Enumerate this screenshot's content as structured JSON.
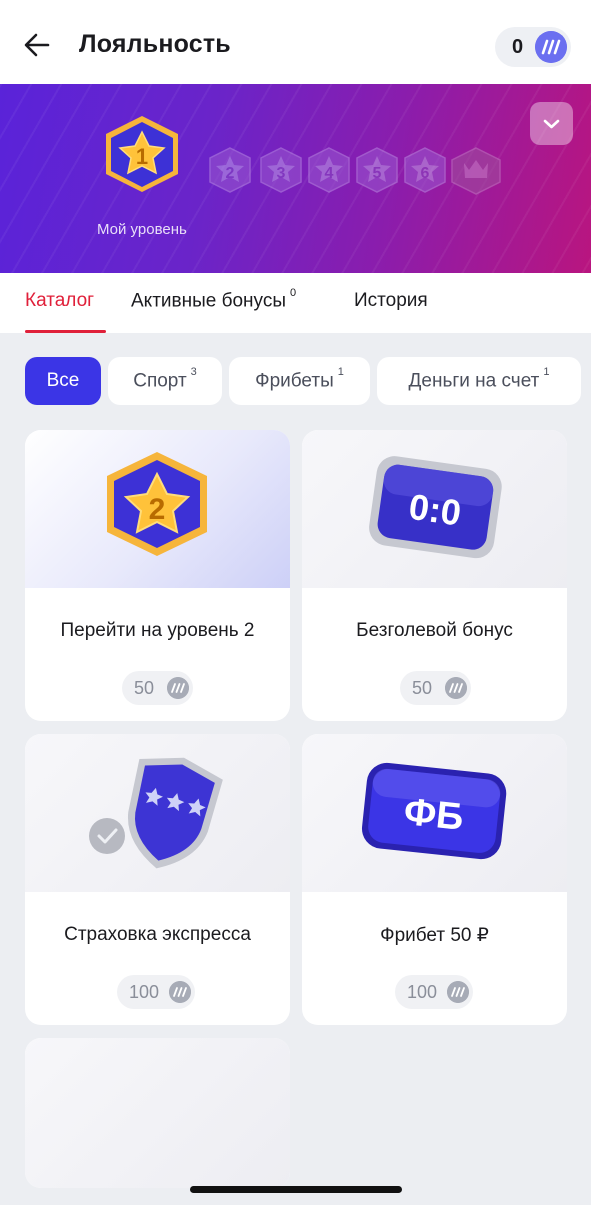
{
  "header": {
    "title": "Лояльность",
    "balance": "0",
    "back_icon": "arrow-left-icon",
    "coin_icon": "loyalty-coin-icon"
  },
  "level": {
    "current": "1",
    "levels": [
      "1",
      "2",
      "3",
      "4",
      "5",
      "6"
    ],
    "caption": "Мой уровень",
    "expand_icon": "chevron-down-icon",
    "final_icon": "crown-icon"
  },
  "tabs": [
    {
      "label": "Каталог",
      "count": ""
    },
    {
      "label": "Активные бонусы",
      "count": "0"
    },
    {
      "label": "История",
      "count": ""
    }
  ],
  "filters": [
    {
      "label": "Все",
      "count": ""
    },
    {
      "label": "Спорт",
      "count": "3"
    },
    {
      "label": "Фрибеты",
      "count": "1"
    },
    {
      "label": "Деньги на счет",
      "count": "1"
    }
  ],
  "cards": [
    {
      "title": "Перейти на уровень 2",
      "price": "50",
      "icon": "level-2-badge-icon"
    },
    {
      "title": "Безголевой бонус",
      "price": "50",
      "icon": "score-0-0-icon",
      "icon_text": "0:0"
    },
    {
      "title": "Страховка экспресса",
      "price": "100",
      "icon": "insurance-shield-icon"
    },
    {
      "title": "Фрибет 50 ₽",
      "price": "100",
      "icon": "freebet-icon",
      "icon_text": "ФБ"
    }
  ],
  "colors": {
    "accent": "#3b35e6",
    "tab_active": "#e0203a",
    "banner_start": "#5a23d9",
    "banner_end": "#b9157f"
  }
}
